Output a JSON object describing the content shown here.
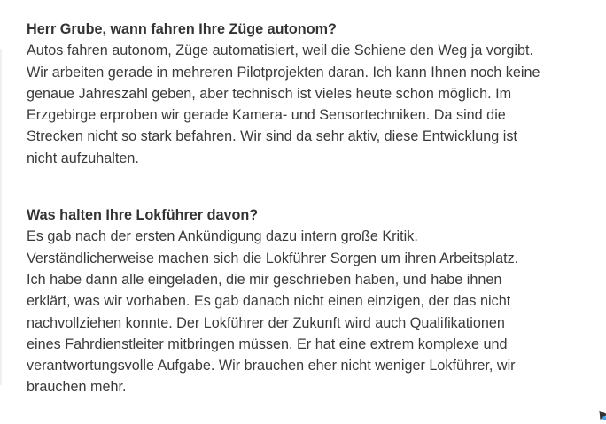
{
  "interview": [
    {
      "question": "Herr Grube, wann fahren Ihre Züge autonom?",
      "lines": [
        "Autos fahren autonom, Züge automatisiert, weil die Schiene den Weg ja vorgibt.",
        "Wir arbeiten gerade in mehreren Pilotprojekten daran. Ich kann Ihnen noch keine",
        "genaue Jahreszahl geben, aber technisch ist vieles heute schon möglich. Im",
        "Erzgebirge erproben wir gerade Kamera- und Sensortechniken. Da sind die",
        "Strecken nicht so stark befahren. Wir sind da sehr aktiv, diese Entwicklung ist",
        "nicht aufzuhalten."
      ]
    },
    {
      "question": "Was halten Ihre Lokführer davon?",
      "lines": [
        "Es gab nach der ersten Ankündigung dazu intern große Kritik.",
        "Verständlicherweise machen sich die Lokführer Sorgen um ihren Arbeitsplatz.",
        "Ich habe dann alle eingeladen, die mir geschrieben haben, und habe ihnen",
        "erklärt, was wir vorhaben. Es gab danach nicht einen einzigen, der das nicht",
        "nachvollziehen konnte. Der Lokführer der Zukunft wird auch Qualifikationen",
        "eines Fahrdienstleiter mitbringen müssen. Er hat eine extrem komplexe und",
        "verantwortungsvolle Aufgabe. Wir brauchen eher nicht weniger Lokführer, wir",
        "brauchen mehr."
      ]
    }
  ]
}
